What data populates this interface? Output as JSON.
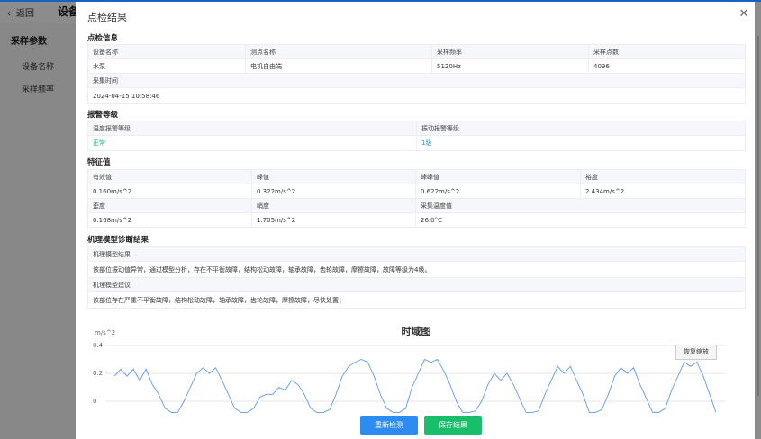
{
  "background": {
    "back_label": "返回",
    "title": "设备",
    "section": "采样参数",
    "item_device_name": "设备名称",
    "item_sample_freq": "采样频率"
  },
  "dialog": {
    "title": "点检结果",
    "close_icon": "close-icon"
  },
  "inspection": {
    "section_title": "点检信息",
    "headers": [
      "设备名称",
      "测点名称",
      "采样频率",
      "采样点数"
    ],
    "values": [
      "水泵",
      "电机自由端",
      "5120Hz",
      "4096"
    ],
    "time_header": "采集时间",
    "time_value": "2024-04-15 10:58:46"
  },
  "alarm": {
    "section_title": "报警等级",
    "headers": [
      "温度报警等级",
      "振动报警等级"
    ],
    "values": [
      "正常",
      "1级"
    ],
    "value_colors": [
      "#19be6b",
      "#2d8cf0"
    ]
  },
  "features": {
    "section_title": "特征值",
    "row1_headers": [
      "有效值",
      "峰值",
      "峰峰值",
      "裕度"
    ],
    "row1_values": [
      "0.160m/s^2",
      "0.322m/s^2",
      "0.622m/s^2",
      "2.434m/s^2"
    ],
    "row2_headers": [
      "歪度",
      "峭度",
      "采集温度值"
    ],
    "row2_values": [
      "0.168m/s^2",
      "1.705m/s^2",
      "26.0°C"
    ]
  },
  "diagnosis": {
    "section_title": "机理模型诊断结果",
    "result_header": "机理模型结果",
    "result_text": "该部位振动值异常，通过模型分析，存在不平衡故障，结构松动故障，轴承故障，齿轮故障，摩擦故障，故障等级为4级。",
    "advice_header": "机理模型建议",
    "advice_text": "该部位存在严重不平衡故障，结构松动故障，轴承故障，齿轮故障，摩擦故障，尽快处置；"
  },
  "chart_data": {
    "type": "line",
    "title": "时域图",
    "ylabel": "m/s^2",
    "ylim": [
      -0.1,
      0.4
    ],
    "y_ticks": [
      "0.4",
      "0.2",
      "0"
    ],
    "reset_label": "恢复缩放",
    "series_color": "#5b9bf0",
    "series": [
      {
        "values": [
          0.18,
          0.23,
          0.18,
          0.23,
          0.15,
          0.23,
          0.12,
          0.05,
          -0.05,
          -0.08,
          -0.08,
          0.0,
          0.1,
          0.2,
          0.24,
          0.2,
          0.24,
          0.15,
          0.05,
          -0.05,
          -0.08,
          -0.08,
          -0.05,
          0.03,
          0.05,
          0.05,
          0.1,
          0.08,
          0.15,
          0.12,
          0.05,
          -0.05,
          -0.08,
          -0.08,
          -0.06,
          0.05,
          0.18,
          0.25,
          0.28,
          0.3,
          0.28,
          0.18,
          0.05,
          -0.05,
          -0.08,
          -0.08,
          -0.05,
          0.1,
          0.2,
          0.3,
          0.28,
          0.3,
          0.22,
          0.12,
          0.0,
          -0.08,
          -0.08,
          -0.07,
          0.0,
          0.12,
          0.2,
          0.15,
          0.2,
          0.12,
          0.02,
          -0.08,
          -0.08,
          -0.07,
          0.05,
          0.15,
          0.25,
          0.2,
          0.25,
          0.15,
          0.05,
          -0.08,
          -0.08,
          -0.06,
          0.05,
          0.18,
          0.24,
          0.2,
          0.24,
          0.12,
          0.02,
          -0.08,
          -0.08,
          -0.05,
          0.08,
          0.18,
          0.28,
          0.25,
          0.28,
          0.18,
          0.05,
          -0.08
        ]
      }
    ]
  },
  "footer": {
    "redetect_label": "重新检测",
    "save_label": "保存结果"
  }
}
